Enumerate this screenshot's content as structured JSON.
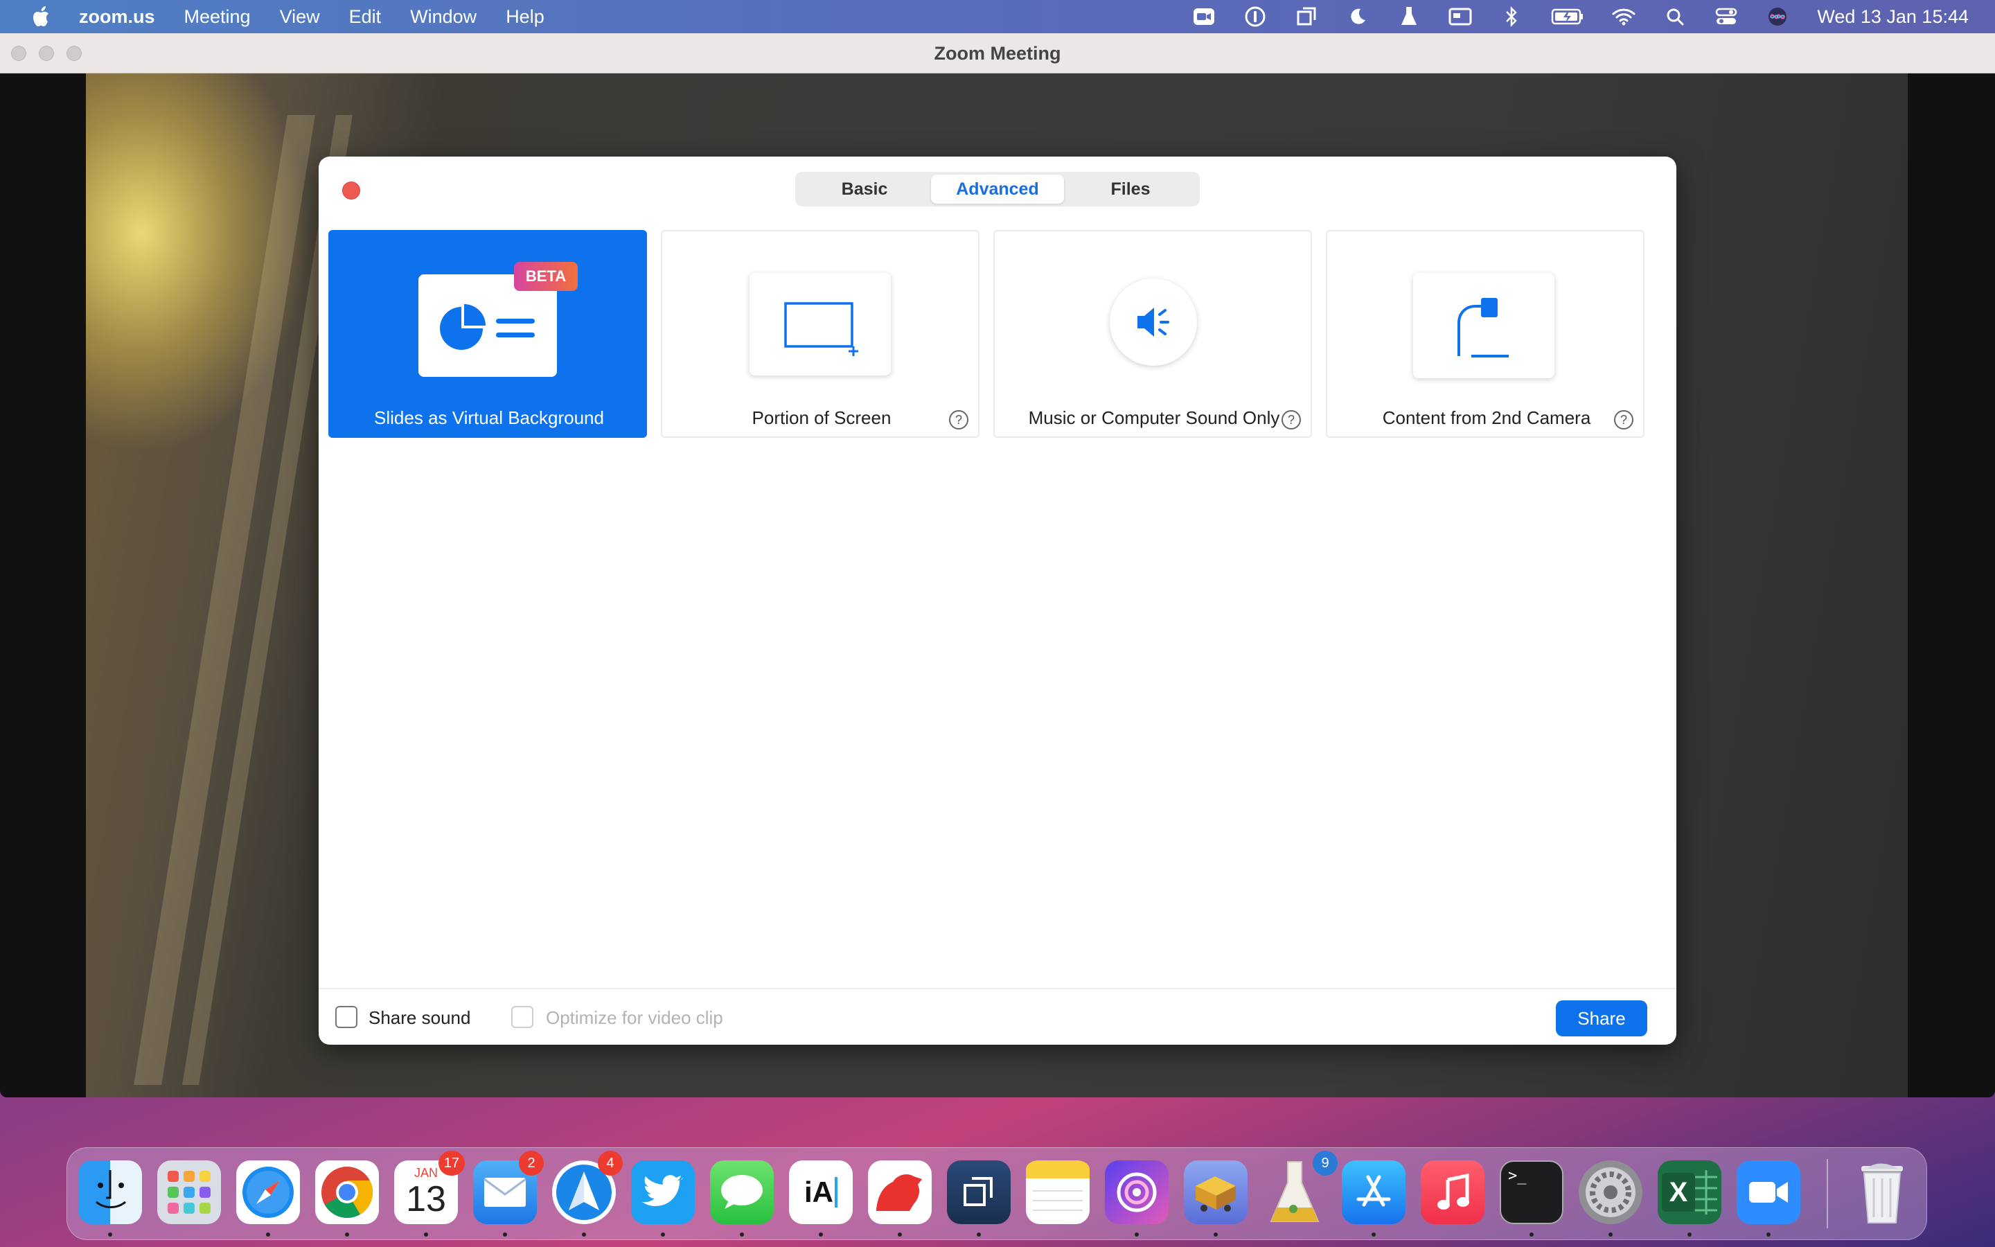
{
  "menubar": {
    "app_name": "zoom.us",
    "items": [
      "Meeting",
      "View",
      "Edit",
      "Window",
      "Help"
    ],
    "status_icons": [
      "zoom-status-icon",
      "onepassword-icon",
      "screens-icon",
      "moon-icon",
      "flask-icon",
      "card-icon",
      "bluetooth-icon",
      "battery-charging-icon",
      "wifi-icon",
      "search-icon",
      "control-center-icon",
      "siri-icon"
    ],
    "clock": "Wed 13 Jan  15:44"
  },
  "window": {
    "title": "Zoom Meeting"
  },
  "dialog": {
    "tabs": [
      {
        "label": "Basic",
        "active": false
      },
      {
        "label": "Advanced",
        "active": true
      },
      {
        "label": "Files",
        "active": false
      }
    ],
    "options": [
      {
        "label": "Slides as Virtual Background",
        "selected": true,
        "badge": "BETA",
        "icon": "slides-icon"
      },
      {
        "label": "Portion of Screen",
        "selected": false,
        "icon": "screen-portion-icon",
        "help": "?"
      },
      {
        "label": "Music or Computer Sound Only",
        "selected": false,
        "icon": "speaker-icon",
        "help": "?"
      },
      {
        "label": "Content from 2nd Camera",
        "selected": false,
        "icon": "document-camera-icon",
        "help": "?"
      }
    ],
    "footer": {
      "share_sound_label": "Share sound",
      "share_sound_checked": false,
      "optimize_label": "Optimize for video clip",
      "optimize_enabled": false,
      "share_button": "Share"
    },
    "accent_color": "#0e72ed"
  },
  "dock": {
    "apps": [
      {
        "name": "Finder",
        "icon": "finder-icon"
      },
      {
        "name": "Launchpad",
        "icon": "launchpad-icon"
      },
      {
        "name": "Safari",
        "icon": "safari-icon"
      },
      {
        "name": "Chrome",
        "icon": "chrome-icon"
      },
      {
        "name": "Calendar",
        "icon": "calendar-icon",
        "month": "JAN",
        "day": "13",
        "badge": "17"
      },
      {
        "name": "Mail",
        "icon": "mail-icon",
        "badge": "2"
      },
      {
        "name": "Spark",
        "icon": "spark-icon",
        "badge": "4"
      },
      {
        "name": "Twitter",
        "icon": "twitter-icon"
      },
      {
        "name": "Messages",
        "icon": "messages-icon"
      },
      {
        "name": "iA Writer",
        "icon": "ia-writer-icon",
        "text": "iA"
      },
      {
        "name": "Bear",
        "icon": "bear-icon"
      },
      {
        "name": "Screens",
        "icon": "screens-app-icon"
      },
      {
        "name": "Notes",
        "icon": "notes-icon"
      },
      {
        "name": "Nova",
        "icon": "nova-icon"
      },
      {
        "name": "Transmit",
        "icon": "transmit-icon"
      },
      {
        "name": "Flask",
        "icon": "flask-app-icon",
        "badge": "9"
      },
      {
        "name": "App Store",
        "icon": "app-store-icon"
      },
      {
        "name": "Music",
        "icon": "music-icon"
      },
      {
        "name": "Terminal",
        "icon": "terminal-icon",
        "text": ">_"
      },
      {
        "name": "System Preferences",
        "icon": "system-preferences-icon"
      },
      {
        "name": "Excel",
        "icon": "excel-icon",
        "text": "X"
      },
      {
        "name": "Zoom",
        "icon": "zoom-icon"
      },
      {
        "name": "Trash",
        "icon": "trash-icon"
      }
    ]
  }
}
